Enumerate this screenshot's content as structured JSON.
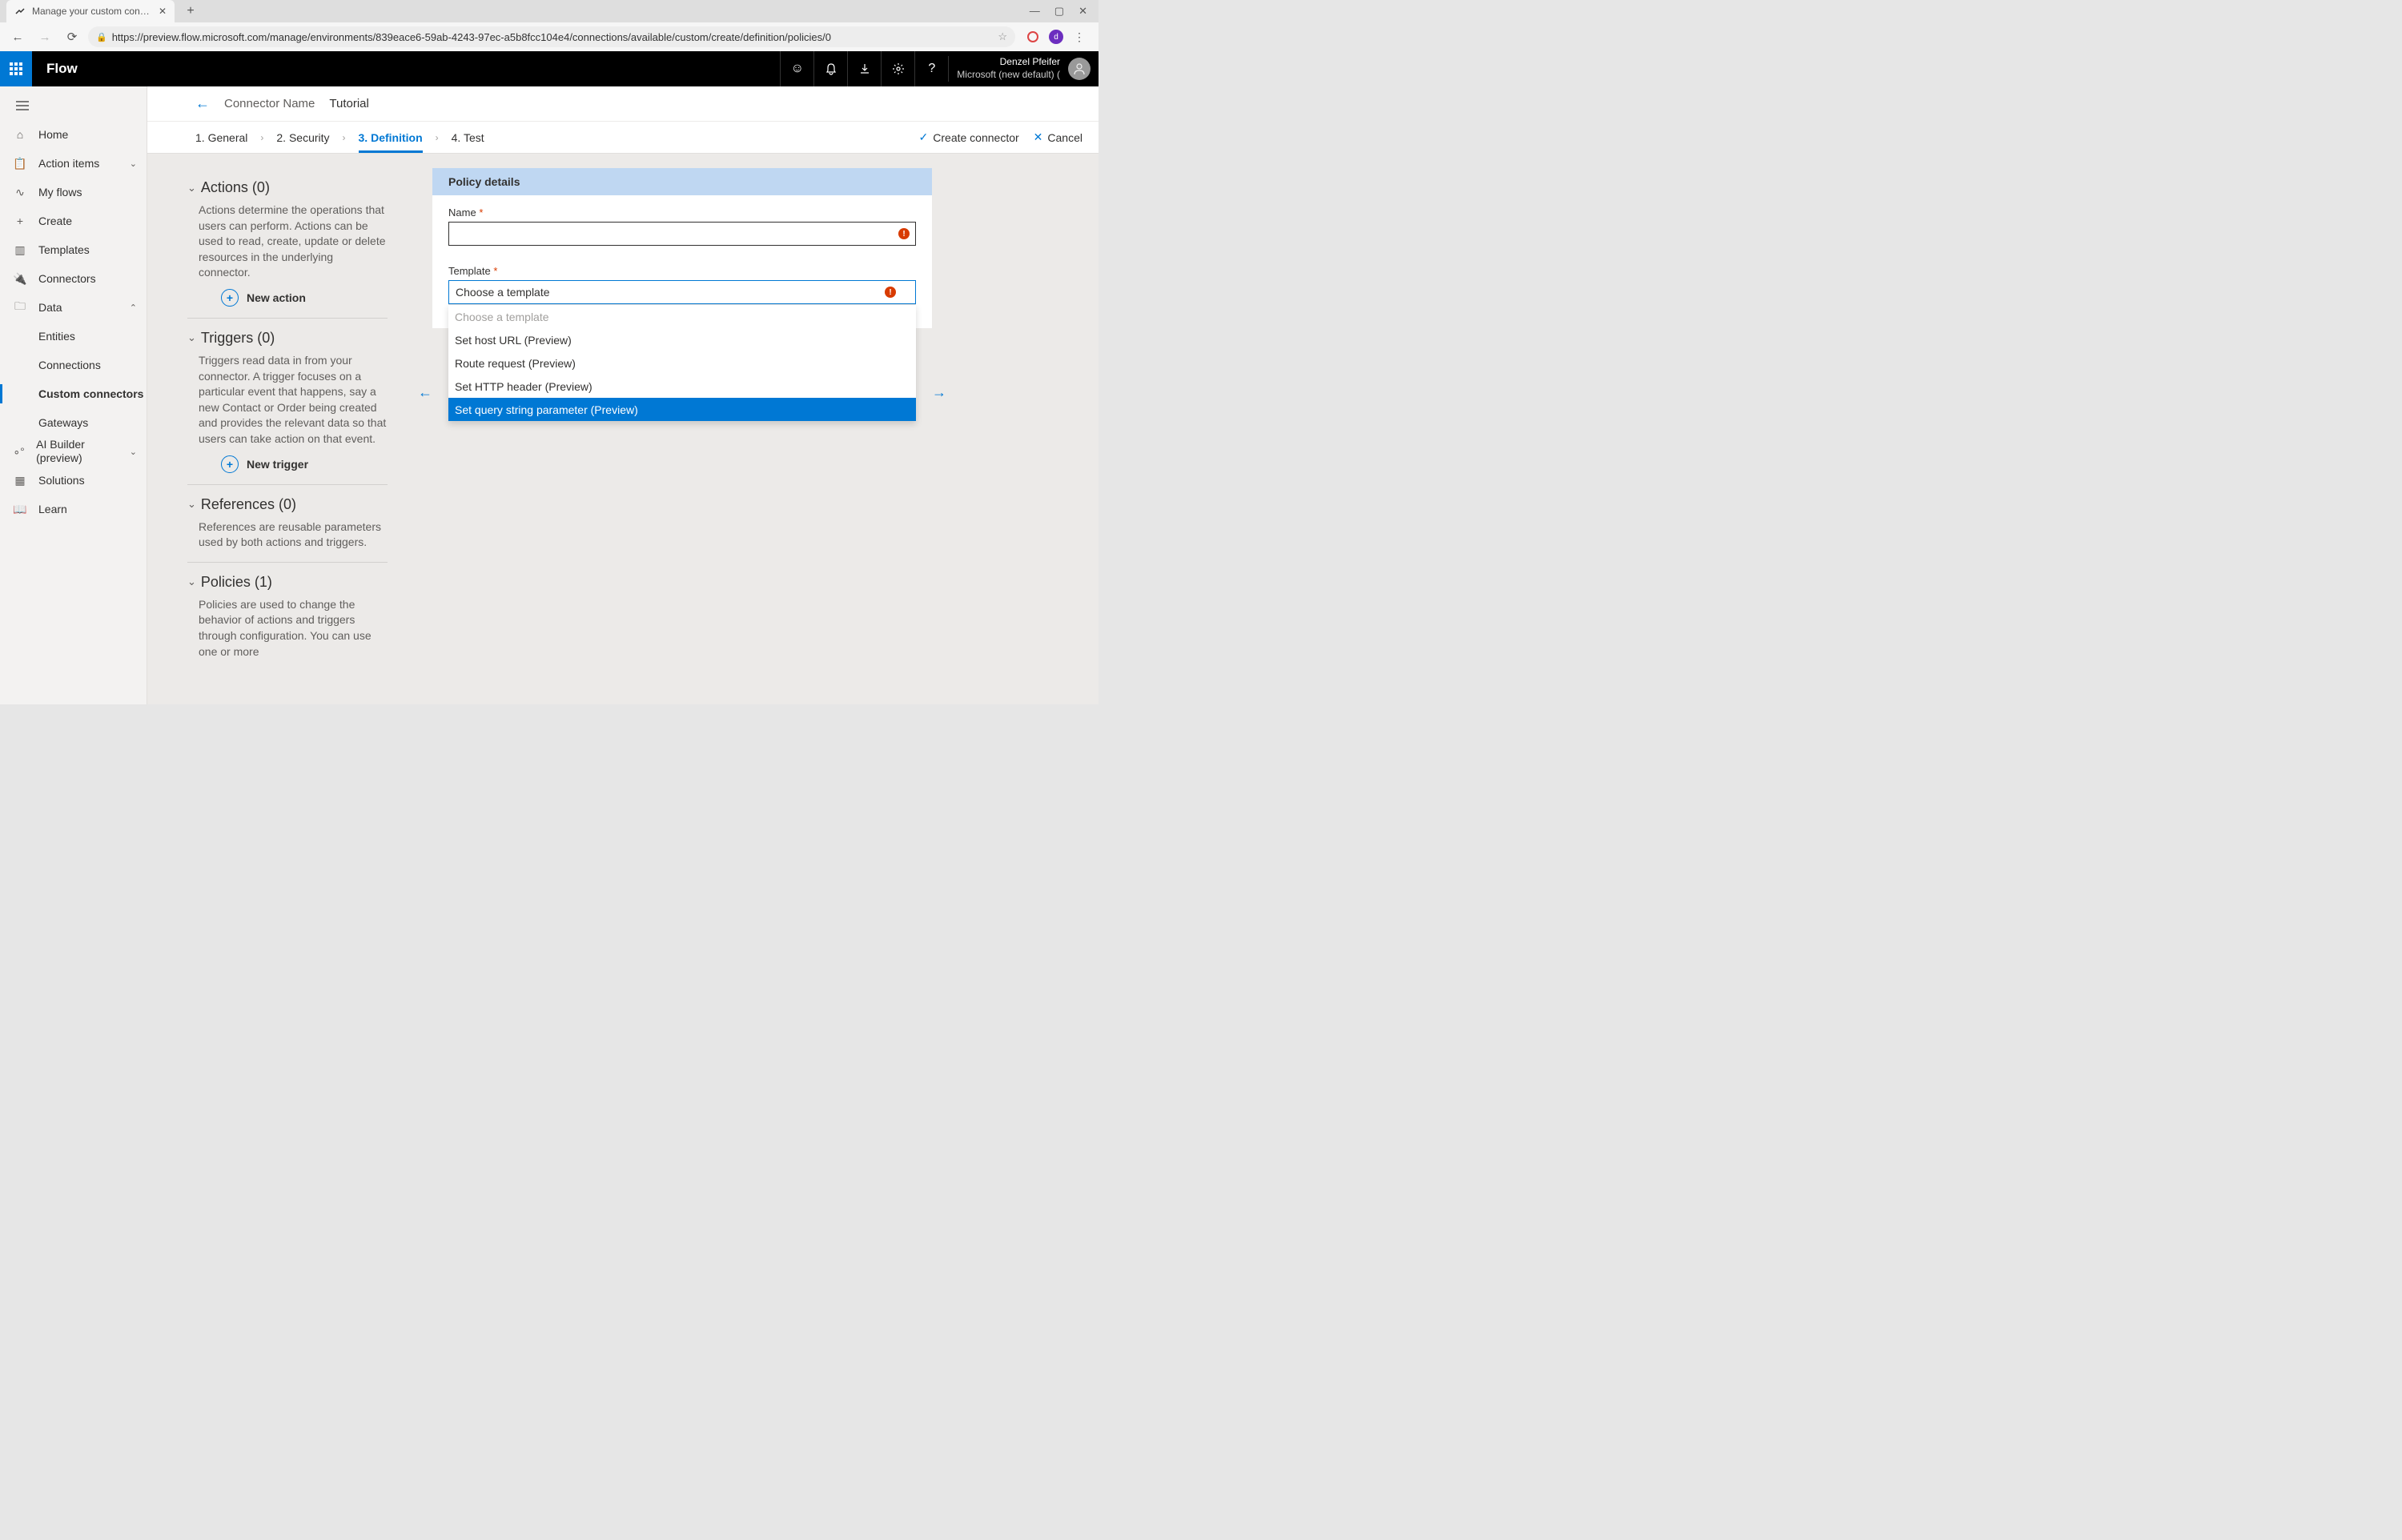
{
  "browser": {
    "tab_title": "Manage your custom connectors",
    "url": "https://preview.flow.microsoft.com/manage/environments/839eace6-59ab-4243-97ec-a5b8fcc104e4/connections/available/custom/create/definition/policies/0",
    "profile_initial": "d"
  },
  "topbar": {
    "app_name": "Flow",
    "user_name": "Denzel Pfeifer",
    "tenant": "Microsoft (new default) ("
  },
  "sidebar": {
    "home": "Home",
    "action_items": "Action items",
    "my_flows": "My flows",
    "create": "Create",
    "templates": "Templates",
    "connectors": "Connectors",
    "data": "Data",
    "entities": "Entities",
    "connections": "Connections",
    "custom_connectors": "Custom connectors",
    "gateways": "Gateways",
    "ai_builder": "AI Builder (preview)",
    "solutions": "Solutions",
    "learn": "Learn"
  },
  "header": {
    "connector_label": "Connector Name",
    "connector_name": "Tutorial"
  },
  "steps": {
    "s1": "1. General",
    "s2": "2. Security",
    "s3": "3. Definition",
    "s4": "4. Test",
    "create": "Create connector",
    "cancel": "Cancel"
  },
  "sections": {
    "actions": {
      "title": "Actions (0)",
      "desc": "Actions determine the operations that users can perform. Actions can be used to read, create, update or delete resources in the underlying connector.",
      "btn": "New action"
    },
    "triggers": {
      "title": "Triggers (0)",
      "desc": "Triggers read data in from your connector. A trigger focuses on a particular event that happens, say a new Contact or Order being created and provides the relevant data so that users can take action on that event.",
      "btn": "New trigger"
    },
    "references": {
      "title": "References (0)",
      "desc": "References are reusable parameters used by both actions and triggers."
    },
    "policies": {
      "title": "Policies (1)",
      "desc": "Policies are used to change the behavior of actions and triggers through configuration. You can use one or more"
    }
  },
  "policy": {
    "header": "Policy details",
    "name_label": "Name",
    "template_label": "Template",
    "template_value": "Choose a template",
    "options": {
      "placeholder": "Choose a template",
      "o1": "Set host URL (Preview)",
      "o2": "Route request (Preview)",
      "o3": "Set HTTP header (Preview)",
      "o4": "Set query string parameter (Preview)"
    }
  }
}
